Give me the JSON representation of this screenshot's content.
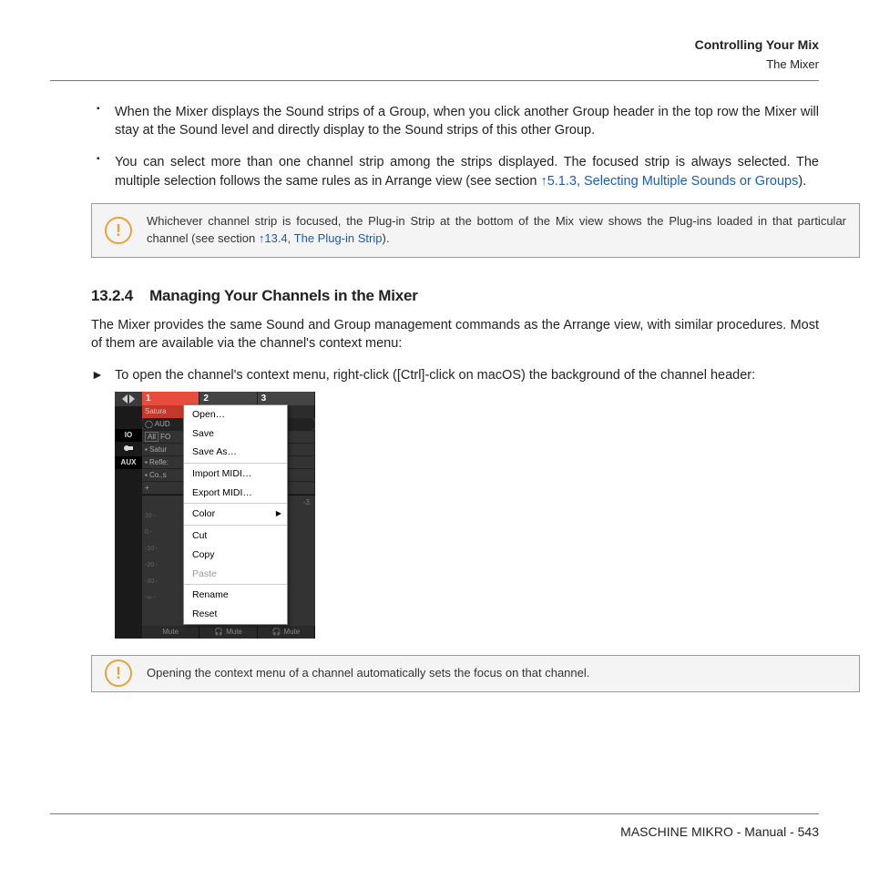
{
  "header": {
    "title": "Controlling Your Mix",
    "subtitle": "The Mixer"
  },
  "bullets": {
    "b1": "When the Mixer displays the Sound strips of a Group, when you click another Group header in the top row the Mixer will stay at the Sound level and directly display to the Sound strips of this other Group.",
    "b2a": "You can select more than one channel strip among the strips displayed. The focused strip is always selected. The multiple selection follows the same rules as in Arrange view (see section ",
    "b2link": "↑5.1.3, Selecting Multiple Sounds or Groups",
    "b2b": ")."
  },
  "callout1": {
    "a": "Whichever channel strip is focused, the Plug-in Strip at the bottom of the Mix view shows the Plug-ins loaded in that particular channel (see section ",
    "link": "↑13.4, The Plug-in Strip",
    "b": ")."
  },
  "section": {
    "num": "13.2.4",
    "title": "Managing Your Channels in the Mixer"
  },
  "body1": "The Mixer provides the same Sound and Group management commands as the Arrange view, with similar procedures. Most of them are available via the channel's context menu:",
  "proc1": "To open the channel's context menu, right-click ([Ctrl]-click on macOS) the background of the channel header:",
  "callout2": "Opening the context menu of a channel automatically sets the focus on that channel.",
  "footer": "MASCHINE MIKRO - Manual - 543",
  "fig": {
    "tabs": [
      "1",
      "2",
      "3"
    ],
    "names": [
      "Satura",
      "",
      ".o"
    ],
    "io": "IO",
    "aux": "AUX",
    "all": "All",
    "fo": "FO",
    "aud": "AUD",
    "lines": [
      "▪ Satur",
      "▪ Refle:",
      "▪ Co..s"
    ],
    "plus": "+",
    "mute": "Mute",
    "scale": [
      "10 -",
      "0 -",
      "-10 -",
      "-20 -",
      "-30 -",
      "-∞ -"
    ],
    "menu": {
      "open": "Open…",
      "save": "Save",
      "saveas": "Save As…",
      "importmidi": "Import MIDI…",
      "exportmidi": "Export MIDI…",
      "color": "Color",
      "cut": "Cut",
      "copy": "Copy",
      "paste": "Paste",
      "rename": "Rename",
      "reset": "Reset"
    }
  }
}
